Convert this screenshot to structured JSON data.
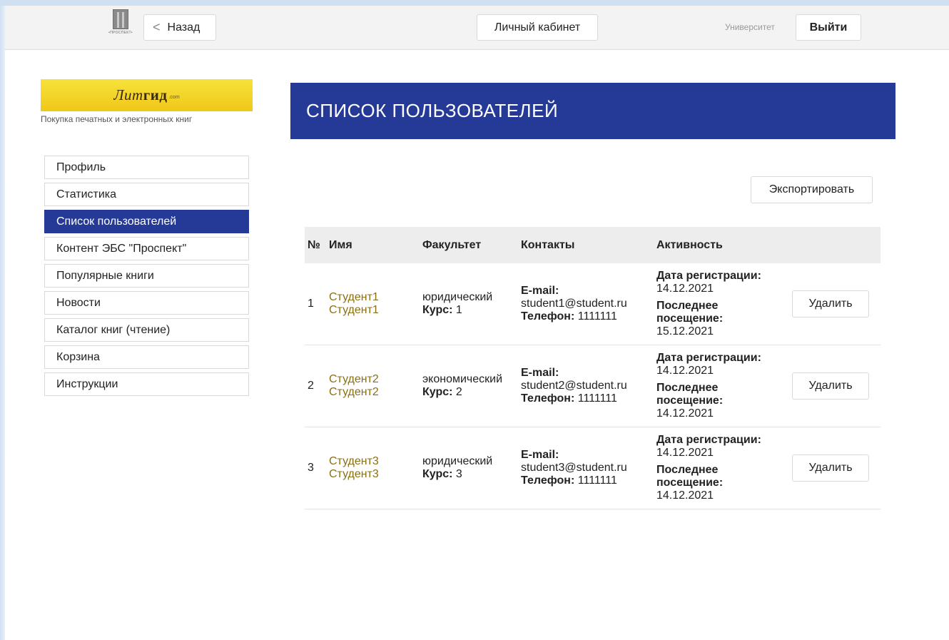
{
  "header": {
    "logo_text": "•ПРОСПЕКТ•",
    "back_label": "Назад",
    "cabinet_label": "Личный кабинет",
    "university_label": "Университет",
    "logout_label": "Выйти"
  },
  "sidebar": {
    "banner_script": "Лит",
    "banner_bold": "гид",
    "banner_domain": ".com",
    "tagline": "Покупка печатных и электронных книг",
    "items": [
      {
        "label": "Профиль",
        "active": false
      },
      {
        "label": "Статистика",
        "active": false
      },
      {
        "label": "Список пользователей",
        "active": true
      },
      {
        "label": "Контент ЭБС \"Проспект\"",
        "active": false
      },
      {
        "label": "Популярные книги",
        "active": false
      },
      {
        "label": "Новости",
        "active": false
      },
      {
        "label": "Каталог книг (чтение)",
        "active": false
      },
      {
        "label": "Корзина",
        "active": false
      },
      {
        "label": "Инструкции",
        "active": false
      }
    ]
  },
  "main": {
    "title": "СПИСОК ПОЛЬЗОВАТЕЛЕЙ",
    "export_label": "Экспортировать",
    "columns": [
      "№",
      "Имя",
      "Факультет",
      "Контакты",
      "Активность"
    ],
    "labels": {
      "course": "Курс:",
      "email": "E-mail:",
      "phone": "Телефон:",
      "registered": "Дата регистрации:",
      "last_visit": "Последнее посещение:",
      "delete": "Удалить"
    },
    "users": [
      {
        "num": "1",
        "first": "Студент1",
        "last": "Студент1",
        "faculty": "юридический",
        "course": "1",
        "email": "student1@student.ru",
        "phone": "1111111",
        "registered": "14.12.2021",
        "last_visit": "15.12.2021"
      },
      {
        "num": "2",
        "first": "Студент2",
        "last": "Студент2",
        "faculty": "экономический",
        "course": "2",
        "email": "student2@student.ru",
        "phone": "1111111",
        "registered": "14.12.2021",
        "last_visit": "14.12.2021"
      },
      {
        "num": "3",
        "first": "Студент3",
        "last": "Студент3",
        "faculty": "юридический",
        "course": "3",
        "email": "student3@student.ru",
        "phone": "1111111",
        "registered": "14.12.2021",
        "last_visit": "14.12.2021"
      }
    ]
  }
}
